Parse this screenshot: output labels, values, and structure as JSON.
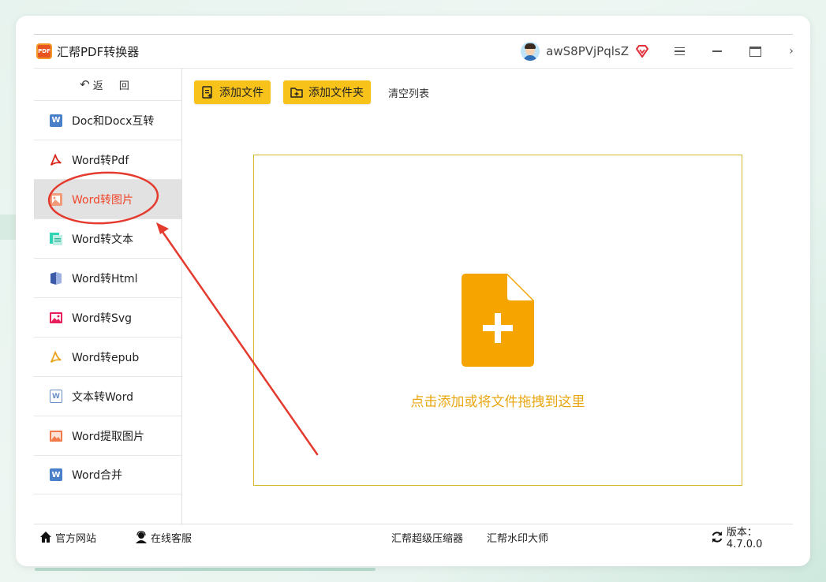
{
  "app": {
    "title": "汇帮PDF转换器",
    "logo_text": "PDF",
    "username": "awS8PVjPqlsZ"
  },
  "sidebar": {
    "back_label": "返 回",
    "items": [
      {
        "label": "Doc和Docx互转",
        "icon": "word-icon",
        "active": false
      },
      {
        "label": "Word转Pdf",
        "icon": "pdf-icon",
        "active": false
      },
      {
        "label": "Word转图片",
        "icon": "image-icon",
        "active": true
      },
      {
        "label": "Word转文本",
        "icon": "text-icon",
        "active": false
      },
      {
        "label": "Word转Html",
        "icon": "html-icon",
        "active": false
      },
      {
        "label": "Word转Svg",
        "icon": "svg-icon",
        "active": false
      },
      {
        "label": "Word转epub",
        "icon": "epub-icon",
        "active": false
      },
      {
        "label": "文本转Word",
        "icon": "word-outline-icon",
        "active": false
      },
      {
        "label": "Word提取图片",
        "icon": "extract-image-icon",
        "active": false
      },
      {
        "label": "Word合并",
        "icon": "word-icon",
        "active": false
      }
    ]
  },
  "toolbar": {
    "add_file": "添加文件",
    "add_folder": "添加文件夹",
    "clear_list": "清空列表"
  },
  "dropzone": {
    "text": "点击添加或将文件拖拽到这里"
  },
  "footer": {
    "website": "官方网站",
    "support": "在线客服",
    "compressor": "汇帮超级压缩器",
    "watermark": "汇帮水印大师",
    "version": "版本：4.7.0.0"
  },
  "colors": {
    "accent_yellow": "#f7c31a",
    "active_red": "#f0462a",
    "drop_text": "#e8a712",
    "annotation_red": "#e53a2e"
  }
}
